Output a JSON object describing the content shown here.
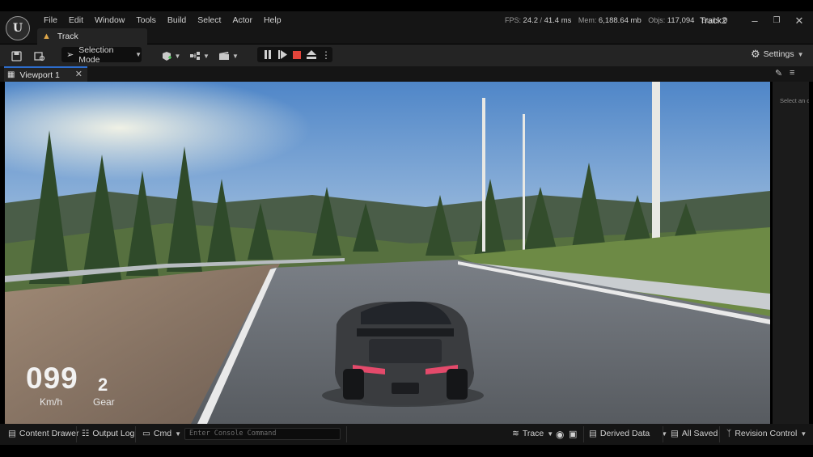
{
  "menu": {
    "items": [
      "File",
      "Edit",
      "Window",
      "Tools",
      "Build",
      "Select",
      "Actor",
      "Help"
    ]
  },
  "stats": {
    "fps_label": "FPS:",
    "fps": "24.2",
    "ms_label": "/",
    "ms": "41.4 ms",
    "mem_label": "Mem:",
    "mem": "6,188.64 mb",
    "objs_label": "Objs:",
    "objs": "117,094",
    "stalls_label": "Stalls:",
    "stalls": "0"
  },
  "project_name": "Track2",
  "document_tab": {
    "label": "Track"
  },
  "toolbar": {
    "selection_mode": "Selection Mode",
    "settings": "Settings"
  },
  "viewport_tab": {
    "label": "Viewport 1"
  },
  "hud": {
    "speed": "099",
    "speed_unit": "Km/h",
    "gear": "2",
    "gear_label": "Gear"
  },
  "side_panel": {
    "hint": "Select an o"
  },
  "statusbar": {
    "content_drawer": "Content Drawer",
    "output_log": "Output Log",
    "cmd": "Cmd",
    "console_placeholder": "Enter Console Command",
    "trace": "Trace",
    "derived_data": "Derived Data",
    "all_saved": "All Saved",
    "revision_control": "Revision Control"
  },
  "icons": {
    "logo": "unreal-logo",
    "save": "save-icon",
    "browse": "content-browse-icon",
    "add": "add-actor-icon",
    "blueprint": "blueprint-icon",
    "cinematics": "clapperboard-icon",
    "pause": "pause-icon",
    "resume": "play-icon",
    "stop": "stop-icon",
    "eject": "eject-icon",
    "more": "kebab-icon",
    "settings": "gear-icon"
  },
  "colors": {
    "accent": "#2d6ccc",
    "stop": "#e2443a",
    "toolbar_bg": "#242424",
    "menubar_bg": "#151515"
  }
}
